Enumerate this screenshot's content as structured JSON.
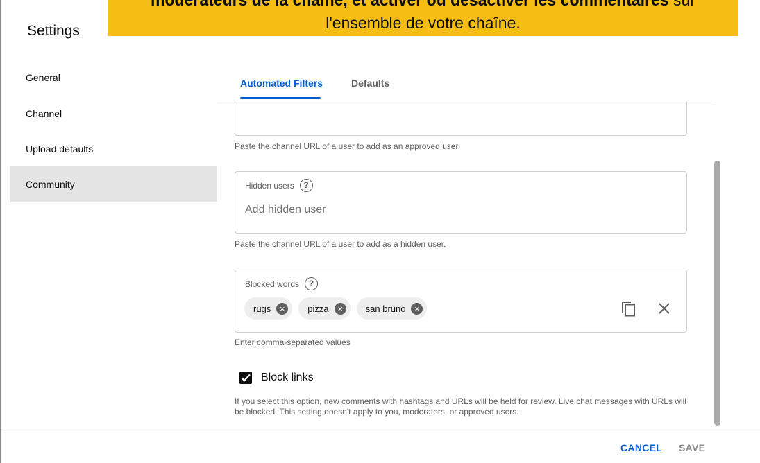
{
  "banner": {
    "line1_bold": "modérateurs de la chaîne, et activer ou désactiver les commentaires",
    "line1_rest": " sur",
    "line2": "l'ensemble de votre chaîne."
  },
  "dialog": {
    "title": "Settings"
  },
  "sidebar": {
    "items": [
      {
        "label": "General"
      },
      {
        "label": "Channel"
      },
      {
        "label": "Upload defaults"
      },
      {
        "label": "Community",
        "active": true
      }
    ]
  },
  "tabs": [
    {
      "label": "Automated Filters",
      "active": true
    },
    {
      "label": "Defaults",
      "active": false
    }
  ],
  "approved_users": {
    "help": "Paste the channel URL of a user to add as an approved user."
  },
  "hidden_users": {
    "label": "Hidden users",
    "placeholder": "Add hidden user",
    "help": "Paste the channel URL of a user to add as a hidden user."
  },
  "blocked_words": {
    "label": "Blocked words",
    "chips": [
      "rugs",
      "pizza",
      "san bruno"
    ],
    "help": "Enter comma-separated values"
  },
  "block_links": {
    "label": "Block links",
    "checked": true,
    "description": "If you select this option, new comments with hashtags and URLs will be held for review. Live chat messages with URLs will be blocked. This setting doesn't apply to you, moderators, or approved users."
  },
  "footer": {
    "cancel": "CANCEL",
    "save": "SAVE"
  },
  "colors": {
    "accent": "#065fd4",
    "banner": "#f6bd12",
    "active_item": "#e5e5e5"
  },
  "icons": {
    "help": "help-circle-icon",
    "chip_remove": "cancel-circle-icon",
    "copy": "copy-icon",
    "clear": "close-icon",
    "checkbox": "checkmark-icon"
  }
}
